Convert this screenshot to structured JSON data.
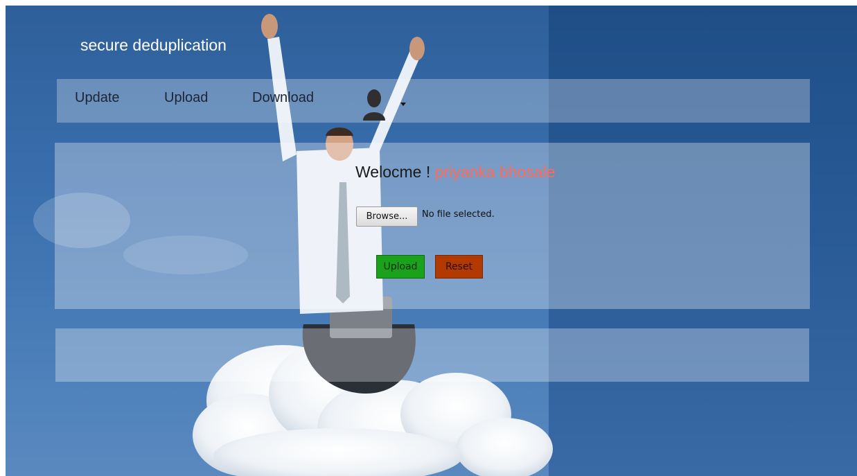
{
  "header": {
    "brand": "secure deduplication"
  },
  "nav": {
    "items": [
      {
        "label": "Update"
      },
      {
        "label": "Upload"
      },
      {
        "label": "Download"
      }
    ],
    "user_menu_icon": "user-silhouette-icon"
  },
  "main": {
    "welcome_prefix": "Welocme !",
    "user_name": "priyanka bhosale",
    "file_input": {
      "button_label": "Browse...",
      "status": "No file selected."
    },
    "upload_button": "Upload",
    "reset_button": "Reset"
  },
  "colors": {
    "upload_button": "#1aa31a",
    "reset_button": "#b23a00",
    "user_name": "#ff6a5a"
  }
}
